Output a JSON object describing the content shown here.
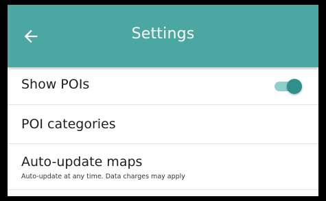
{
  "app_bar": {
    "title": "Settings",
    "back_icon": "arrow-left-icon",
    "color": "#4aa7a1"
  },
  "settings": {
    "show_pois": {
      "label": "Show POIs",
      "enabled": true
    },
    "poi_categories": {
      "label": "POI categories"
    },
    "auto_update_maps": {
      "label": "Auto-update maps",
      "description": "Auto-update at any time. Data charges may apply"
    }
  },
  "colors": {
    "toggle_thumb": "#2f8f8a",
    "toggle_track": "#8ecfcb"
  }
}
